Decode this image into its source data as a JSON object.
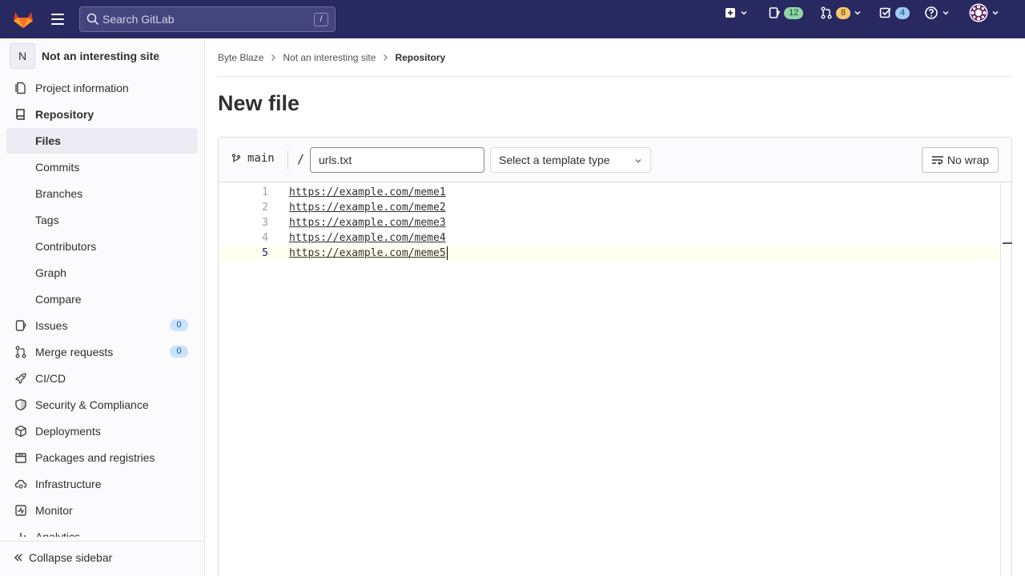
{
  "topbar": {
    "search_placeholder": "Search GitLab",
    "search_shortcut": "/",
    "issues_count": "12",
    "merge_requests_count": "8",
    "todos_count": "4"
  },
  "sidebar": {
    "project_initial": "N",
    "project_name": "Not an interesting site",
    "items": {
      "project_information": "Project information",
      "repository": "Repository",
      "files": "Files",
      "commits": "Commits",
      "branches": "Branches",
      "tags": "Tags",
      "contributors": "Contributors",
      "graph": "Graph",
      "compare": "Compare",
      "issues": "Issues",
      "issues_count": "0",
      "merge_requests": "Merge requests",
      "merge_requests_count": "0",
      "cicd": "CI/CD",
      "security": "Security & Compliance",
      "deployments": "Deployments",
      "packages": "Packages and registries",
      "infrastructure": "Infrastructure",
      "monitor": "Monitor",
      "analytics": "Analytics"
    },
    "collapse_label": "Collapse sidebar"
  },
  "breadcrumb": {
    "group": "Byte Blaze",
    "project": "Not an interesting site",
    "current": "Repository"
  },
  "page": {
    "title": "New file"
  },
  "editor": {
    "branch": "main",
    "path_separator": "/",
    "filename": "urls.txt",
    "template_placeholder": "Select a template type",
    "wrap_label": "No wrap",
    "lines": [
      {
        "num": "1",
        "text": "https://example.com/meme1"
      },
      {
        "num": "2",
        "text": "https://example.com/meme2"
      },
      {
        "num": "3",
        "text": "https://example.com/meme3"
      },
      {
        "num": "4",
        "text": "https://example.com/meme4"
      },
      {
        "num": "5",
        "text": "https://example.com/meme5"
      }
    ]
  }
}
